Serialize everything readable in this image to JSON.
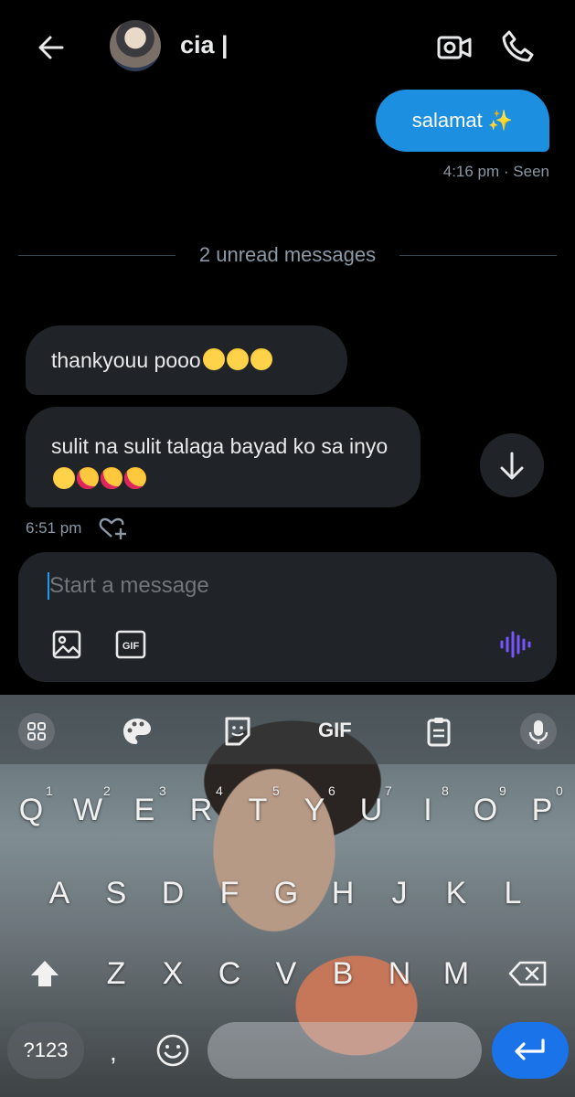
{
  "header": {
    "contact_name": "cia |",
    "back_icon": "arrow-left-icon",
    "video_icon": "video-call-icon",
    "phone_icon": "phone-icon"
  },
  "messages": {
    "sent": {
      "text": "salamat ✨",
      "meta": "4:16 pm · Seen"
    },
    "unread_divider": "2 unread messages",
    "received": [
      {
        "text": "thankyouu pooo"
      },
      {
        "text": "sulit na sulit talaga bayad ko sa inyo"
      }
    ],
    "received_meta": "6:51 pm"
  },
  "composer": {
    "placeholder": "Start a message",
    "gif_label": "GIF"
  },
  "keyboard": {
    "toolbar": {
      "gif": "GIF"
    },
    "row1": [
      "Q",
      "W",
      "E",
      "R",
      "T",
      "Y",
      "U",
      "I",
      "O",
      "P"
    ],
    "row1_numbers": [
      "1",
      "2",
      "3",
      "4",
      "5",
      "6",
      "7",
      "8",
      "9",
      "0"
    ],
    "row2": [
      "A",
      "S",
      "D",
      "F",
      "G",
      "H",
      "J",
      "K",
      "L"
    ],
    "row3": [
      "Z",
      "X",
      "C",
      "V",
      "B",
      "N",
      "M"
    ],
    "symbols_key": "?123",
    "comma_key": ","
  },
  "colors": {
    "accent": "#1d9bf0",
    "sent_bubble": "#1d8fe0",
    "received_bubble": "#202327",
    "enter_key": "#1a73e8",
    "voice": "#7856ff"
  }
}
